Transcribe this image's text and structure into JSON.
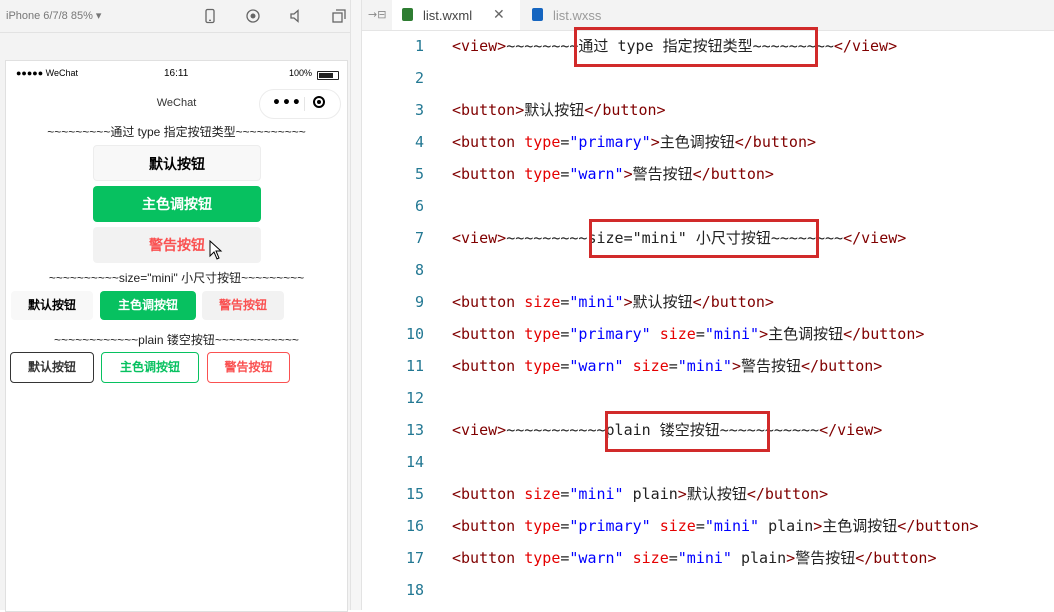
{
  "simulator": {
    "device_label": "iPhone 6/7/8 85% ▾",
    "toolbar_icons": [
      "phone-icon",
      "record-icon",
      "volume-icon",
      "window-icon"
    ],
    "status_bar": {
      "carrier": "●●●●● WeChat",
      "time": "16:11",
      "battery": "100%"
    },
    "nav_title": "WeChat",
    "sections": [
      {
        "title": "~~~~~~~~~通过 type 指定按钮类型~~~~~~~~~~",
        "buttons": [
          {
            "label": "默认按钮",
            "type": "default"
          },
          {
            "label": "主色调按钮",
            "type": "primary"
          },
          {
            "label": "警告按钮",
            "type": "warn"
          }
        ]
      },
      {
        "title": "~~~~~~~~~~size=\"mini\" 小尺寸按钮~~~~~~~~~",
        "buttons": [
          {
            "label": "默认按钮",
            "type": "default"
          },
          {
            "label": "主色调按钮",
            "type": "primary"
          },
          {
            "label": "警告按钮",
            "type": "warn"
          }
        ]
      },
      {
        "title": "~~~~~~~~~~~~plain 镂空按钮~~~~~~~~~~~~",
        "buttons": [
          {
            "label": "默认按钮",
            "type": "default"
          },
          {
            "label": "主色调按钮",
            "type": "primary"
          },
          {
            "label": "警告按钮",
            "type": "warn"
          }
        ]
      }
    ]
  },
  "editor": {
    "tabs": [
      {
        "label": "list.wxml",
        "active": true
      },
      {
        "label": "list.wxss",
        "active": false
      }
    ],
    "lines": [
      {
        "n": "1",
        "tokens": [
          [
            "tag",
            "<view>"
          ],
          [
            "plain-text",
            "~~~~~~~~通过 type 指定按钮类型~~~~~~~~~"
          ],
          [
            "tag",
            "</view>"
          ]
        ]
      },
      {
        "n": "2",
        "tokens": []
      },
      {
        "n": "3",
        "tokens": [
          [
            "tag",
            "<button>"
          ],
          [
            "plain-text",
            "默认按钮"
          ],
          [
            "tag",
            "</button>"
          ]
        ]
      },
      {
        "n": "4",
        "tokens": [
          [
            "tag",
            "<button "
          ],
          [
            "attr",
            "type"
          ],
          [
            "plain-text",
            "="
          ],
          [
            "str",
            "\"primary\""
          ],
          [
            "tag",
            ">"
          ],
          [
            "plain-text",
            "主色调按钮"
          ],
          [
            "tag",
            "</button>"
          ]
        ]
      },
      {
        "n": "5",
        "tokens": [
          [
            "tag",
            "<button "
          ],
          [
            "attr",
            "type"
          ],
          [
            "plain-text",
            "="
          ],
          [
            "str",
            "\"warn\""
          ],
          [
            "tag",
            ">"
          ],
          [
            "plain-text",
            "警告按钮"
          ],
          [
            "tag",
            "</button>"
          ]
        ]
      },
      {
        "n": "6",
        "tokens": []
      },
      {
        "n": "7",
        "tokens": [
          [
            "tag",
            "<view>"
          ],
          [
            "plain-text",
            "~~~~~~~~~size=\"mini\" 小尺寸按钮~~~~~~~~"
          ],
          [
            "tag",
            "</view>"
          ]
        ]
      },
      {
        "n": "8",
        "tokens": []
      },
      {
        "n": "9",
        "tokens": [
          [
            "tag",
            "<button "
          ],
          [
            "attr",
            "size"
          ],
          [
            "plain-text",
            "="
          ],
          [
            "str",
            "\"mini\""
          ],
          [
            "tag",
            ">"
          ],
          [
            "plain-text",
            "默认按钮"
          ],
          [
            "tag",
            "</button>"
          ]
        ]
      },
      {
        "n": "10",
        "tokens": [
          [
            "tag",
            "<button "
          ],
          [
            "attr",
            "type"
          ],
          [
            "plain-text",
            "="
          ],
          [
            "str",
            "\"primary\""
          ],
          [
            "plain-text",
            " "
          ],
          [
            "attr",
            "size"
          ],
          [
            "plain-text",
            "="
          ],
          [
            "str",
            "\"mini\""
          ],
          [
            "tag",
            ">"
          ],
          [
            "plain-text",
            "主色调按钮"
          ],
          [
            "tag",
            "</button>"
          ]
        ]
      },
      {
        "n": "11",
        "tokens": [
          [
            "tag",
            "<button "
          ],
          [
            "attr",
            "type"
          ],
          [
            "plain-text",
            "="
          ],
          [
            "str",
            "\"warn\""
          ],
          [
            "plain-text",
            " "
          ],
          [
            "attr",
            "size"
          ],
          [
            "plain-text",
            "="
          ],
          [
            "str",
            "\"mini\""
          ],
          [
            "tag",
            ">"
          ],
          [
            "plain-text",
            "警告按钮"
          ],
          [
            "tag",
            "</button>"
          ]
        ]
      },
      {
        "n": "12",
        "tokens": []
      },
      {
        "n": "13",
        "tokens": [
          [
            "tag",
            "<view>"
          ],
          [
            "plain-text",
            "~~~~~~~~~~~plain 镂空按钮~~~~~~~~~~~"
          ],
          [
            "tag",
            "</view>"
          ]
        ]
      },
      {
        "n": "14",
        "tokens": []
      },
      {
        "n": "15",
        "tokens": [
          [
            "tag",
            "<button "
          ],
          [
            "attr",
            "size"
          ],
          [
            "plain-text",
            "="
          ],
          [
            "str",
            "\"mini\""
          ],
          [
            "plain-text",
            " plain"
          ],
          [
            "tag",
            ">"
          ],
          [
            "plain-text",
            "默认按钮"
          ],
          [
            "tag",
            "</button>"
          ]
        ]
      },
      {
        "n": "16",
        "tokens": [
          [
            "tag",
            "<button "
          ],
          [
            "attr",
            "type"
          ],
          [
            "plain-text",
            "="
          ],
          [
            "str",
            "\"primary\""
          ],
          [
            "plain-text",
            " "
          ],
          [
            "attr",
            "size"
          ],
          [
            "plain-text",
            "="
          ],
          [
            "str",
            "\"mini\""
          ],
          [
            "plain-text",
            " plain"
          ],
          [
            "tag",
            ">"
          ],
          [
            "plain-text",
            "主色调按钮"
          ],
          [
            "tag",
            "</button>"
          ]
        ]
      },
      {
        "n": "17",
        "tokens": [
          [
            "tag",
            "<button "
          ],
          [
            "attr",
            "type"
          ],
          [
            "plain-text",
            "="
          ],
          [
            "str",
            "\"warn\""
          ],
          [
            "plain-text",
            " "
          ],
          [
            "attr",
            "size"
          ],
          [
            "plain-text",
            "="
          ],
          [
            "str",
            "\"mini\""
          ],
          [
            "plain-text",
            " plain"
          ],
          [
            "tag",
            ">"
          ],
          [
            "plain-text",
            "警告按钮"
          ],
          [
            "tag",
            "</button>"
          ]
        ]
      },
      {
        "n": "18",
        "tokens": []
      }
    ]
  },
  "colors": {
    "primary": "#07c160",
    "warn": "#fa5151",
    "highlight": "#d12a2a",
    "wxml_icon": "#2e7d32",
    "wxss_icon": "#1565c0"
  }
}
